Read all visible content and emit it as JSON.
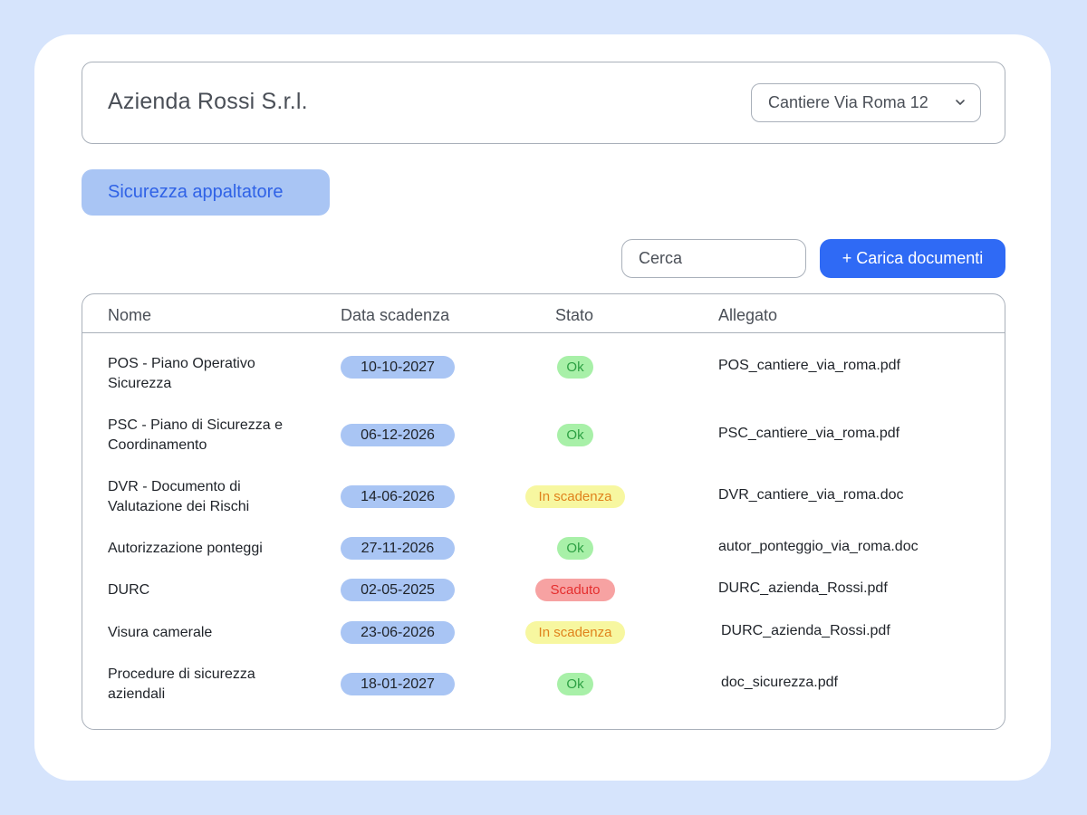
{
  "header": {
    "company": "Azienda Rossi S.r.l.",
    "site_selected": "Cantiere Via Roma 12"
  },
  "tabs": [
    {
      "label": "Sicurezza appaltatore",
      "active": true
    }
  ],
  "toolbar": {
    "search_placeholder": "Cerca",
    "upload_label": "+ Carica documenti"
  },
  "table": {
    "columns": [
      "Nome",
      "Data scadenza",
      "Stato",
      "Allegato"
    ],
    "rows": [
      {
        "name": "POS - Piano Operativo Sicurezza",
        "date": "10-10-2027",
        "status": "Ok",
        "status_type": "ok",
        "file": "POS_cantiere_via_roma.pdf"
      },
      {
        "name": "PSC - Piano di Sicurezza e Coordinamento",
        "date": "06-12-2026",
        "status": "Ok",
        "status_type": "ok",
        "file": "PSC_cantiere_via_roma.pdf"
      },
      {
        "name": "DVR - Documento di Valutazione dei Rischi",
        "date": "14-06-2026",
        "status": "In scadenza",
        "status_type": "warn",
        "file": "DVR_cantiere_via_roma.doc"
      },
      {
        "name": "Autorizzazione ponteggi",
        "date": "27-11-2026",
        "status": "Ok",
        "status_type": "ok",
        "file": "autor_ponteggio_via_roma.doc"
      },
      {
        "name": "DURC",
        "date": "02-05-2025",
        "status": "Scaduto",
        "status_type": "bad",
        "file": "DURC_azienda_Rossi.pdf"
      },
      {
        "name": "Visura camerale",
        "date": "23-06-2026",
        "status": "In scadenza",
        "status_type": "warn",
        "file": "DURC_azienda_Rossi.pdf"
      },
      {
        "name": "Procedure di sicurezza aziendali",
        "date": "18-01-2027",
        "status": "Ok",
        "status_type": "ok",
        "file": "doc_sicurezza.pdf"
      }
    ]
  },
  "colors": {
    "background": "#d6e4fc",
    "accent": "#2f6af5",
    "tab": "#a9c5f4",
    "ok": "#a8f0a8",
    "warn": "#f7f7a0",
    "bad": "#f7a2a2"
  }
}
